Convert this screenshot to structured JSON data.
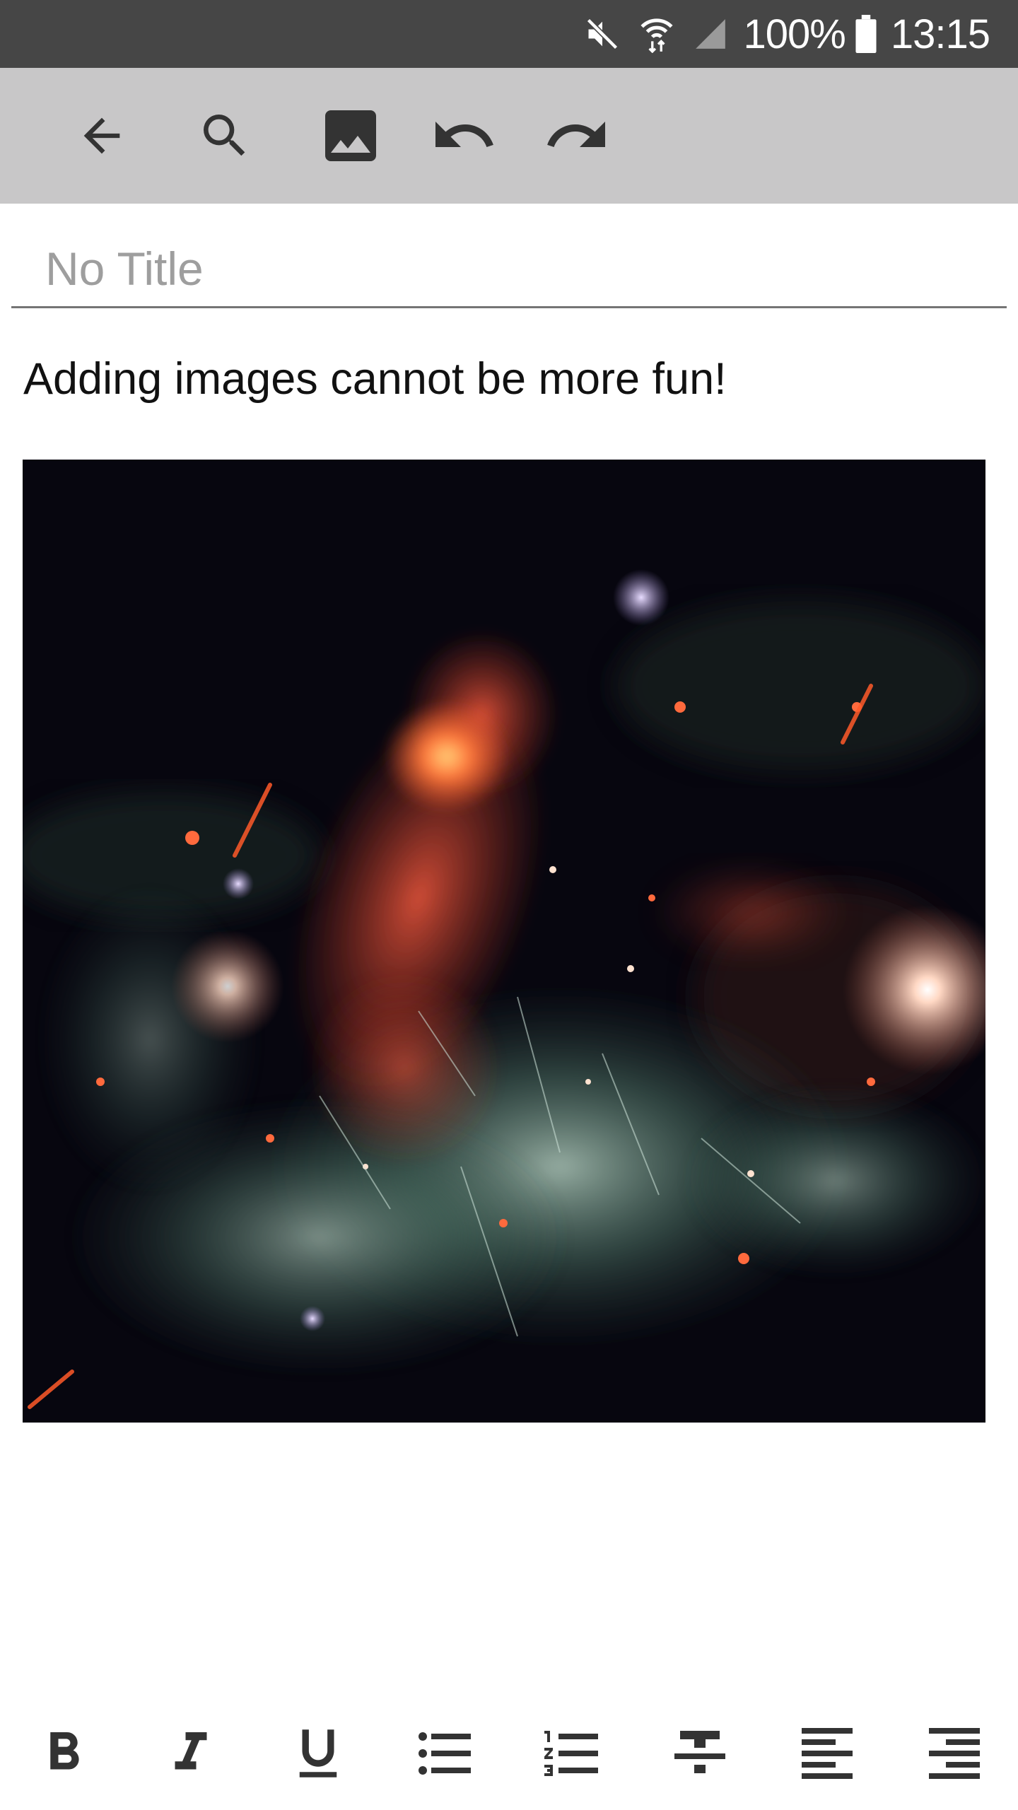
{
  "status_bar": {
    "battery_percent": "100%",
    "time": "13:15",
    "icons": [
      "mute-icon",
      "wifi-icon",
      "signal-icon",
      "battery-icon"
    ]
  },
  "toolbar": {
    "icons": [
      "back-arrow-icon",
      "search-icon",
      "image-icon",
      "undo-icon",
      "redo-icon"
    ]
  },
  "note": {
    "title_value": "",
    "title_placeholder": "No Title",
    "body_text": "Adding images cannot be more fun!"
  },
  "format_bar": {
    "buttons": [
      "bold-icon",
      "italic-icon",
      "underline-icon",
      "bulleted-list-icon",
      "numbered-list-icon",
      "strikethrough-icon",
      "align-left-icon",
      "align-right-icon"
    ]
  },
  "colors": {
    "status_bar_bg": "#464646",
    "toolbar_bg": "#c8c7c8",
    "icon_color": "#333333",
    "placeholder": "#9e9e9e",
    "underline": "#757575"
  }
}
